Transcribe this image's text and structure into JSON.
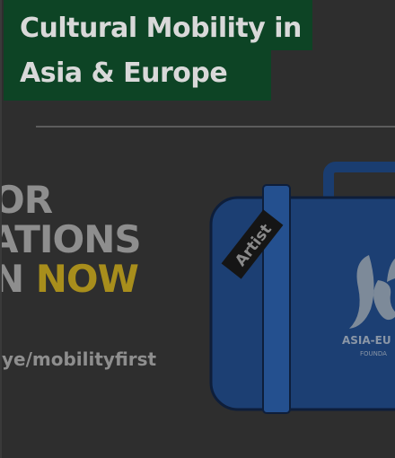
{
  "title": {
    "line1": "Cultural Mobility in",
    "line2": "Asia & Europe"
  },
  "promo": {
    "line1": "OR",
    "line2": "ATIONS",
    "line3_prefix": "N",
    "line3_accent": "NOW",
    "url": "ye/mobilityfirst"
  },
  "suitcase": {
    "tag": "Artist",
    "brand_line1": "ASIA-EU",
    "brand_line2": "FOUNDA"
  },
  "colors": {
    "title_bg": "#0d4425",
    "accent": "#a88e1c",
    "suitcase_blue": "#1c3f73"
  }
}
